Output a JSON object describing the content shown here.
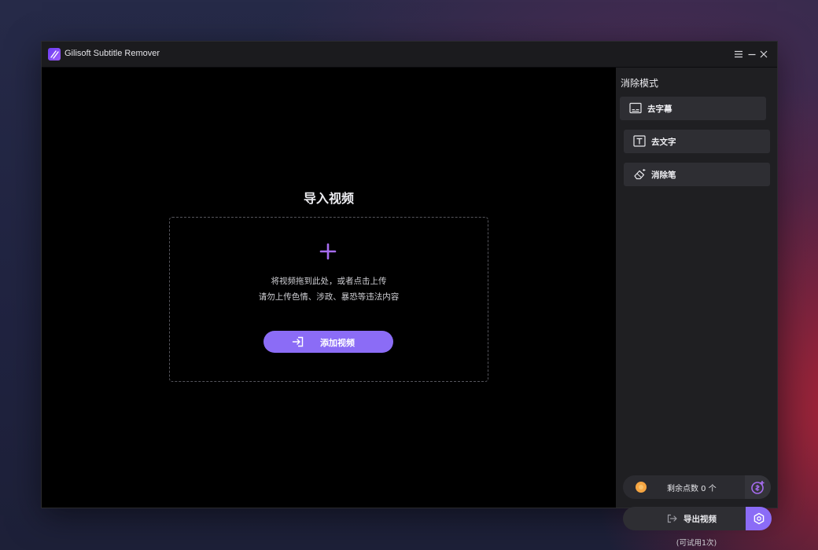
{
  "window": {
    "title": "Gilisoft Subtitle Remover",
    "controls": [
      "menu-icon",
      "minimize-icon",
      "close-icon"
    ]
  },
  "main": {
    "import_title": "导入视频",
    "hint_line1": "将视频拖到此处，或者点击上传",
    "hint_line2": "请勿上传色情、涉政、暴恐等违法内容",
    "add_video_label": "添加视频"
  },
  "sidebar": {
    "title": "消除模式",
    "modes": [
      {
        "label": "去字幕",
        "icon": "subtitle-icon"
      },
      {
        "label": "去文字",
        "icon": "text-icon"
      },
      {
        "label": "消除笔",
        "icon": "eraser-icon"
      }
    ],
    "points_label": "剩余点数 0 个",
    "export_label": "导出视频",
    "trial_note": "(可试用1次)"
  },
  "colors": {
    "accent": "#8b6cf6",
    "coin": "#f5a542"
  }
}
